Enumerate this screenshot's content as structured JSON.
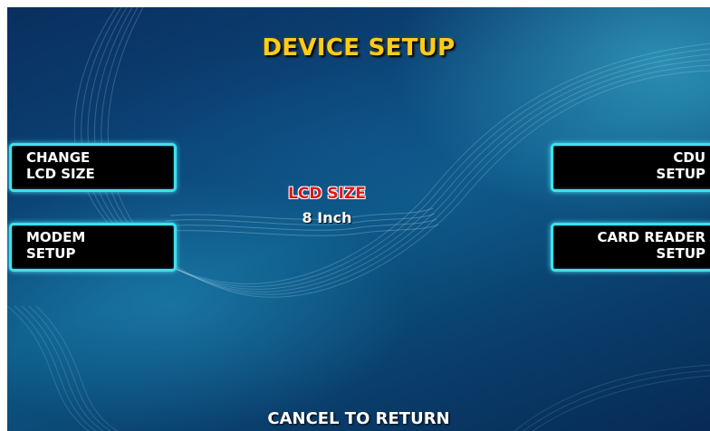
{
  "screen": {
    "title": "DEVICE SETUP",
    "footer": "CANCEL TO RETURN"
  },
  "left_buttons": [
    {
      "line1": "CHANGE",
      "line2": "LCD SIZE"
    },
    {
      "line1": "MODEM",
      "line2": "SETUP"
    }
  ],
  "right_buttons": [
    {
      "line1": "CDU",
      "line2": "SETUP"
    },
    {
      "line1": "CARD READER",
      "line2": "SETUP"
    }
  ],
  "status": {
    "label": "LCD SIZE",
    "value": "8 Inch"
  },
  "colors": {
    "title": "#ffcc1a",
    "button_border": "#3fe0ea",
    "status_label": "#e01818"
  }
}
